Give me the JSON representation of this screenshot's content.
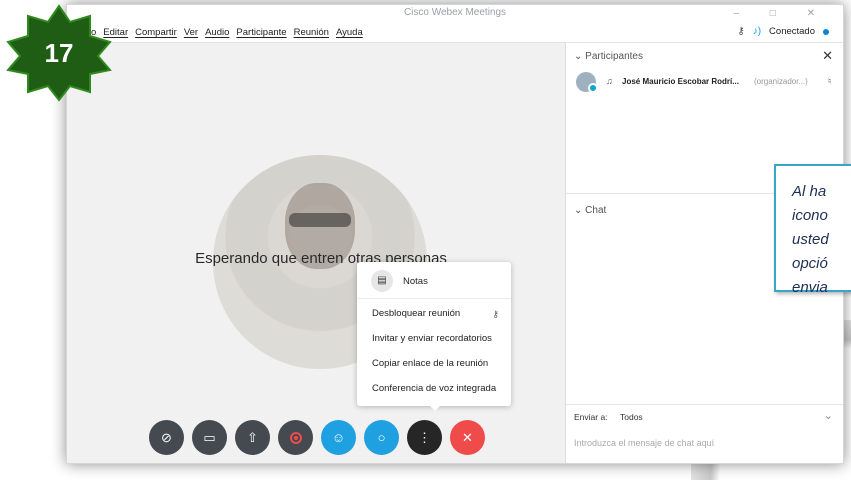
{
  "window": {
    "title": "Cisco Webex Meetings",
    "controls": "–  □  ✕"
  },
  "menu": {
    "items": [
      "Editar",
      "Compartir",
      "Ver",
      "Audio",
      "Participante",
      "Reunión",
      "Ayuda"
    ],
    "left_fragment": "o"
  },
  "status": {
    "connection": "Conectado"
  },
  "meeting": {
    "waiting_text": "Esperando que entren otras personas"
  },
  "popup": {
    "notes": "Notas",
    "unlock": "Desbloquear reunión",
    "invite": "Invitar y enviar recordatorios",
    "copy_link": "Copiar enlace de la reunión",
    "voice_conf": "Conferencia de voz integrada"
  },
  "participants": {
    "header": "Participantes",
    "list": [
      {
        "name": "José Mauricio Escobar Rodrí...",
        "role": "(organizador...)"
      }
    ]
  },
  "chat": {
    "header": "Chat",
    "send_to_label": "Enviar a:",
    "send_to_value": "Todos",
    "input_placeholder": "Introduzca el mensaje de chat aquí"
  },
  "step": {
    "number": "17"
  },
  "callout": {
    "text": "Al ha\nicono\nusted\nopció\nenvia"
  },
  "colors": {
    "badge_green": "#1f5d14",
    "badge_border": "#2f8a1e",
    "accent_blue": "#1fa0e0",
    "end_red": "#ef4b4b",
    "callout_border": "#3ba5c9",
    "callout_text": "#1e2f55"
  },
  "icons": {
    "mute": "mic-off-icon",
    "video": "camera-icon",
    "share": "share-icon",
    "record": "record-icon",
    "participants": "participants-icon",
    "chat": "chat-icon",
    "more": "more-icon",
    "end": "close-icon"
  }
}
